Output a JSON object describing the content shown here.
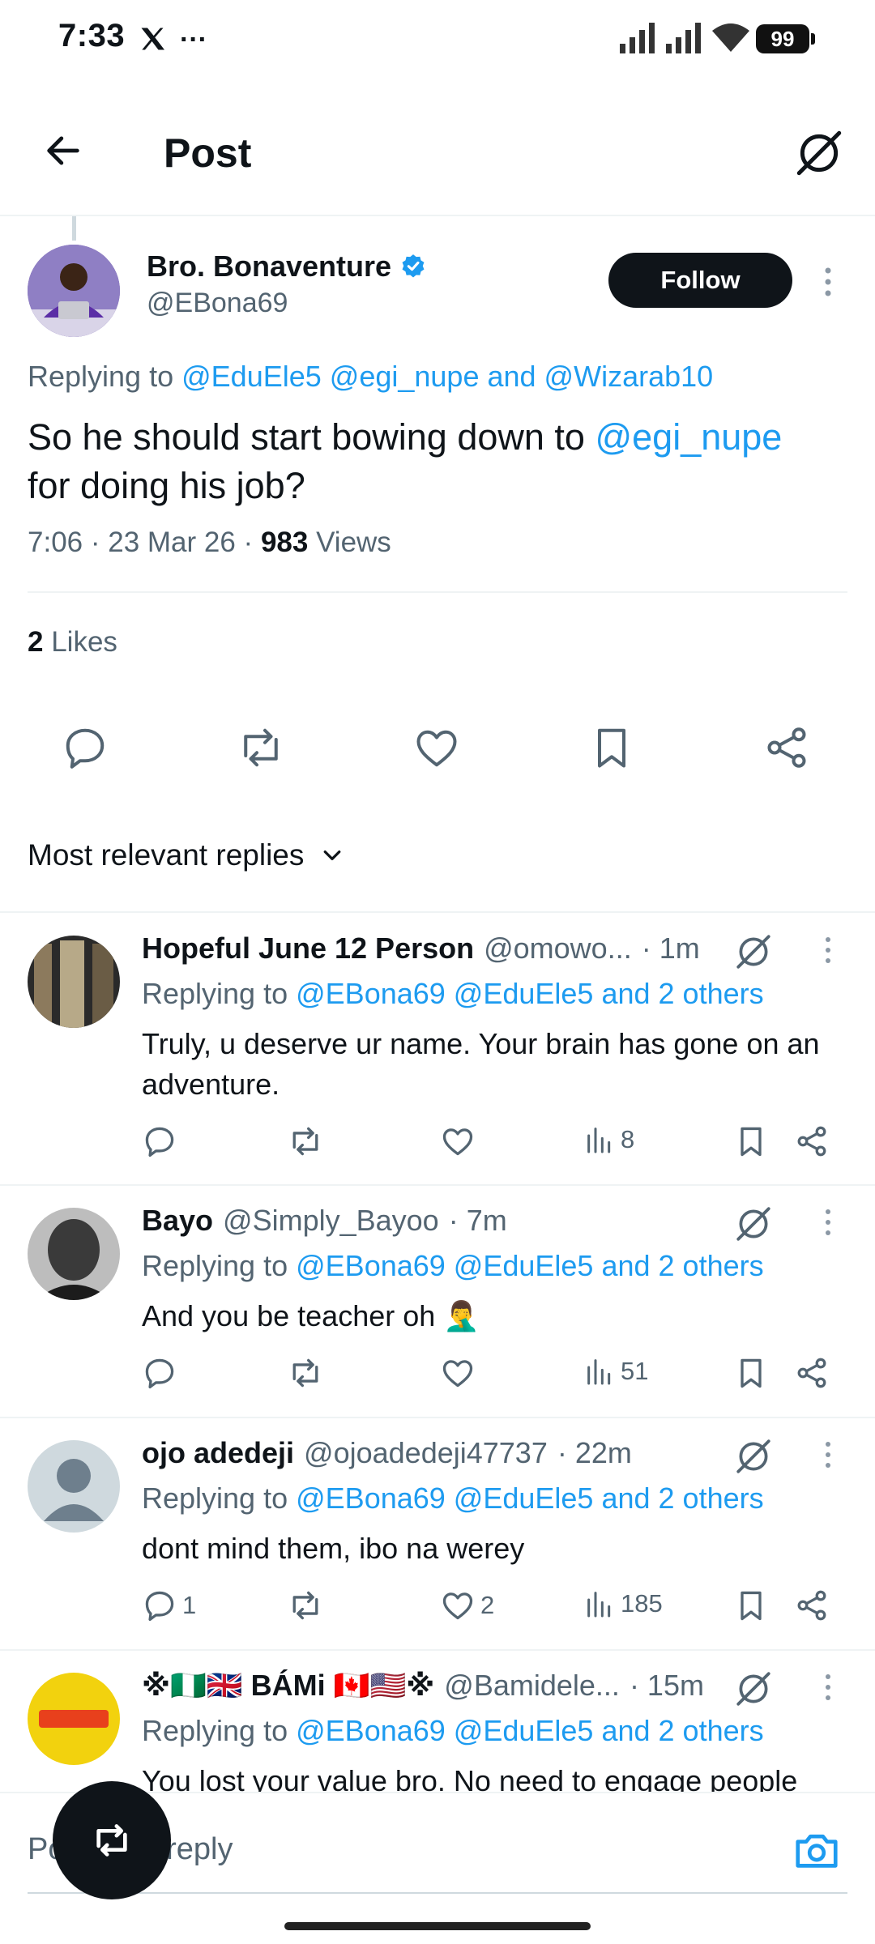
{
  "status_bar": {
    "time": "7:33",
    "battery": "99"
  },
  "header": {
    "title": "Post"
  },
  "tweet": {
    "author_name": "Bro. Bonaventure",
    "author_handle": "@EBona69",
    "follow_label": "Follow",
    "replying_prefix": "Replying to",
    "replying_to": "@EduEle5 @egi_nupe and @Wizarab10",
    "text_part1": "So he should start bowing down to",
    "text_mention": "@egi_nupe",
    "text_part2": "for doing his job?",
    "time_date": "7:06 · 23 Mar 26 ·",
    "views_count": "983",
    "views_label": "Views",
    "likes_count": "2",
    "likes_label": "Likes"
  },
  "sort": {
    "label": "Most relevant replies"
  },
  "replies": [
    {
      "name": "Hopeful June 12 Person",
      "handle": "@omowo...",
      "time": "· 1m",
      "replying_prefix": "Replying to",
      "replying_to": "@EBona69 @EduEle5 and 2 others",
      "text": "Truly, u deserve ur name. Your brain has gone on an adventure.",
      "reply_count": "",
      "like_count": "",
      "views": "8"
    },
    {
      "name": "Bayo",
      "handle": "@Simply_Bayoo",
      "time": "· 7m",
      "replying_prefix": "Replying to",
      "replying_to": "@EBona69 @EduEle5 and 2 others",
      "text": "And you be teacher oh 🤦‍♂️",
      "reply_count": "",
      "like_count": "",
      "views": "51"
    },
    {
      "name": "ojo adedeji",
      "handle": "@ojoadedeji47737",
      "time": "· 22m",
      "replying_prefix": "Replying to",
      "replying_to": "@EBona69 @EduEle5 and 2 others",
      "text": "dont mind them, ibo na werey",
      "reply_count": "1",
      "like_count": "2",
      "views": "185"
    },
    {
      "name": "※🇳🇬🇬🇧 BÁMi 🇨🇦🇺🇸※",
      "handle": "@Bamidele...",
      "time": "· 15m",
      "replying_prefix": "Replying to",
      "replying_to": "@EBona69 @EduEle5 and 2 others",
      "text": "You lost your value bro.  No need to engage people",
      "reply_count": "",
      "like_count": "",
      "views": ""
    }
  ],
  "compose": {
    "placeholder": "Post your reply"
  },
  "colors": {
    "accent": "#1d9bf0",
    "text": "#0f1419",
    "secondary": "#536471"
  }
}
